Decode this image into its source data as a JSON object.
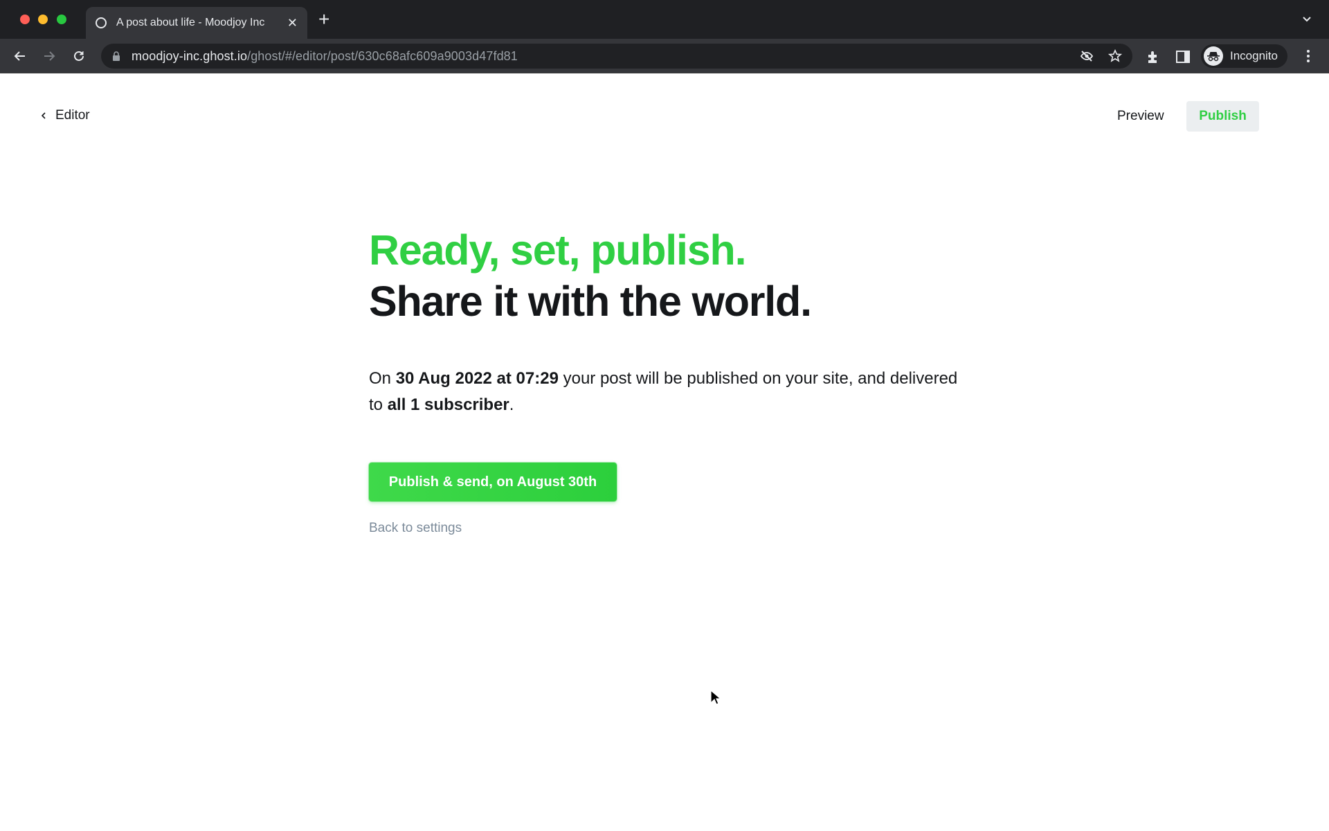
{
  "browser": {
    "tab": {
      "title": "A post about life - Moodjoy Inc",
      "favicon": "circle-icon",
      "close_icon": "close-icon"
    },
    "new_tab_label": "+",
    "url": {
      "host": "moodjoy-inc.ghost.io",
      "path": "/ghost/#/editor/post/630c68afc609a9003d47fd81"
    },
    "profile_label": "Incognito",
    "icons": [
      "back-icon",
      "forward-icon",
      "reload-icon",
      "lock-icon",
      "eye-off-icon",
      "star-icon",
      "extensions-icon",
      "side-panel-icon",
      "incognito-icon",
      "more-icon",
      "chevron-down-icon"
    ]
  },
  "header": {
    "back_label": "Editor",
    "preview_label": "Preview",
    "publish_label": "Publish"
  },
  "main": {
    "headline_1": "Ready, set, publish.",
    "headline_2": "Share it with the world.",
    "summary": {
      "prefix": "On ",
      "datetime": "30 Aug 2022 at 07:29",
      "middle": " your post will be published on your site, and delivered to ",
      "audience": "all 1 subscriber",
      "suffix": "."
    },
    "confirm_button": "Publish & send, on August 30th",
    "back_link": "Back to settings"
  },
  "colors": {
    "accent_green": "#30cf43",
    "text_dark": "#15171a",
    "muted": "#7c8b9a"
  }
}
